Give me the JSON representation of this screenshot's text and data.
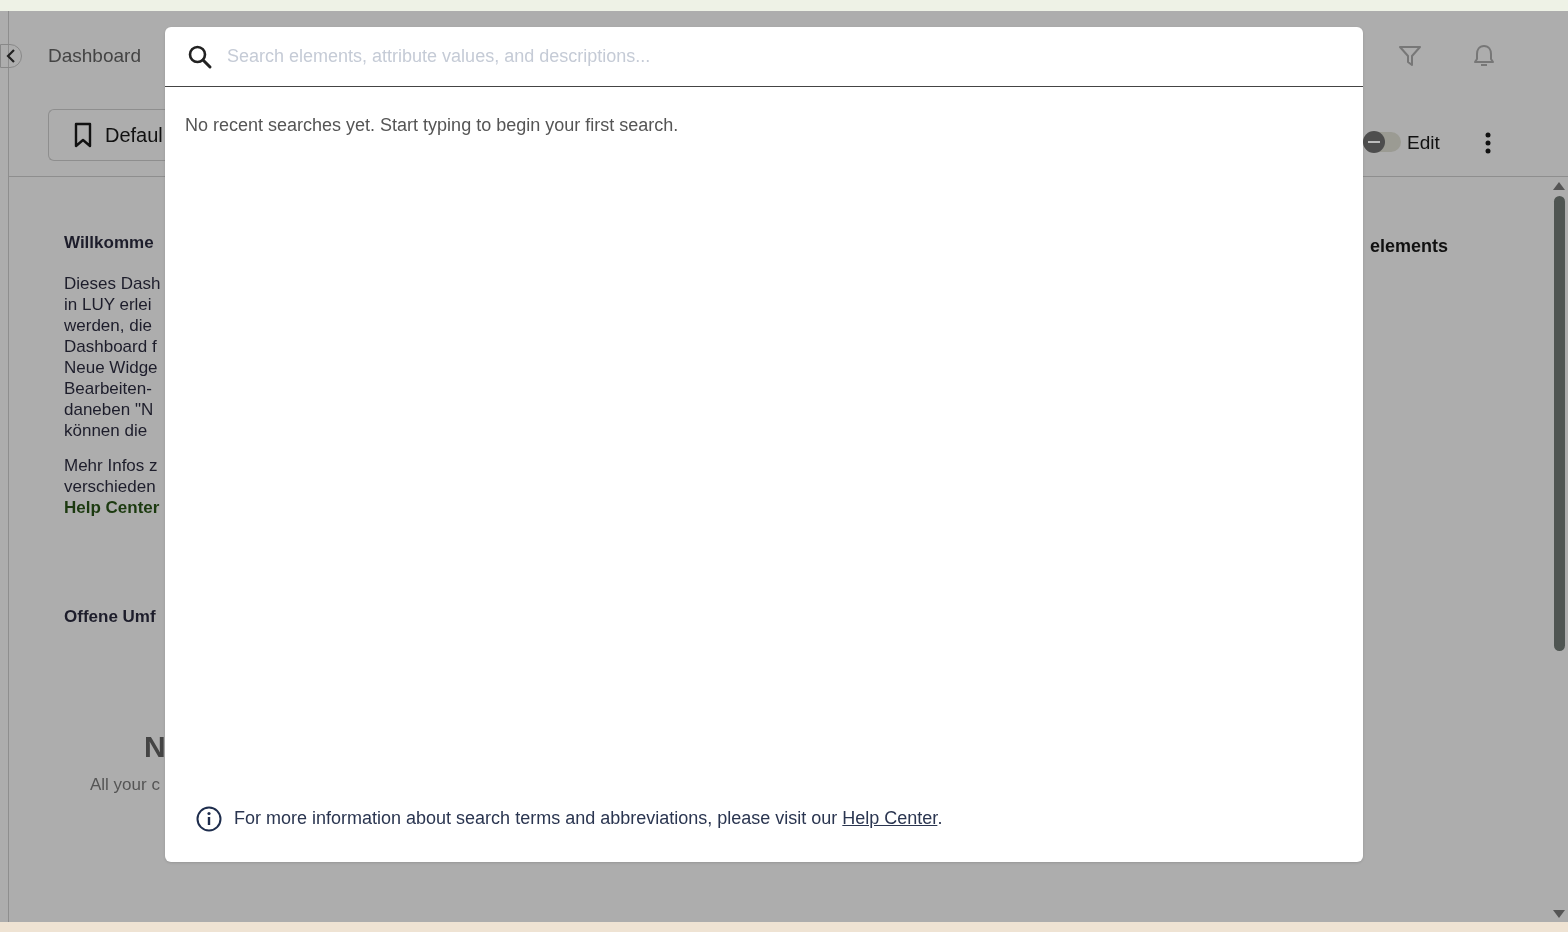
{
  "header": {
    "title": "Dashboard",
    "view_button": "Defaul"
  },
  "toolbar": {
    "edit_toggle": {
      "on": false,
      "label": "Edit"
    }
  },
  "welcome": {
    "title": "Willkomme",
    "lines": [
      "Dieses Dash",
      "in LUY erlei",
      "werden, die",
      "Dashboard f",
      "Neue Widge",
      "Bearbeiten-",
      "daneben \"N",
      "können die"
    ],
    "more_lines": [
      "Mehr Infos z",
      "verschieden"
    ],
    "link": "Help Center"
  },
  "survey": {
    "title": "Offene Umf",
    "empty_title": "N",
    "empty_text": "All your c"
  },
  "right_widget": {
    "title": "elements"
  },
  "search_dialog": {
    "placeholder": "Search elements, attribute values, and descriptions...",
    "empty_message": "No recent searches yet. Start typing to begin your first search.",
    "footer_text": "For more information about search terms and abbreviations, please visit our",
    "footer_link": "Help Center",
    "footer_end": "."
  }
}
